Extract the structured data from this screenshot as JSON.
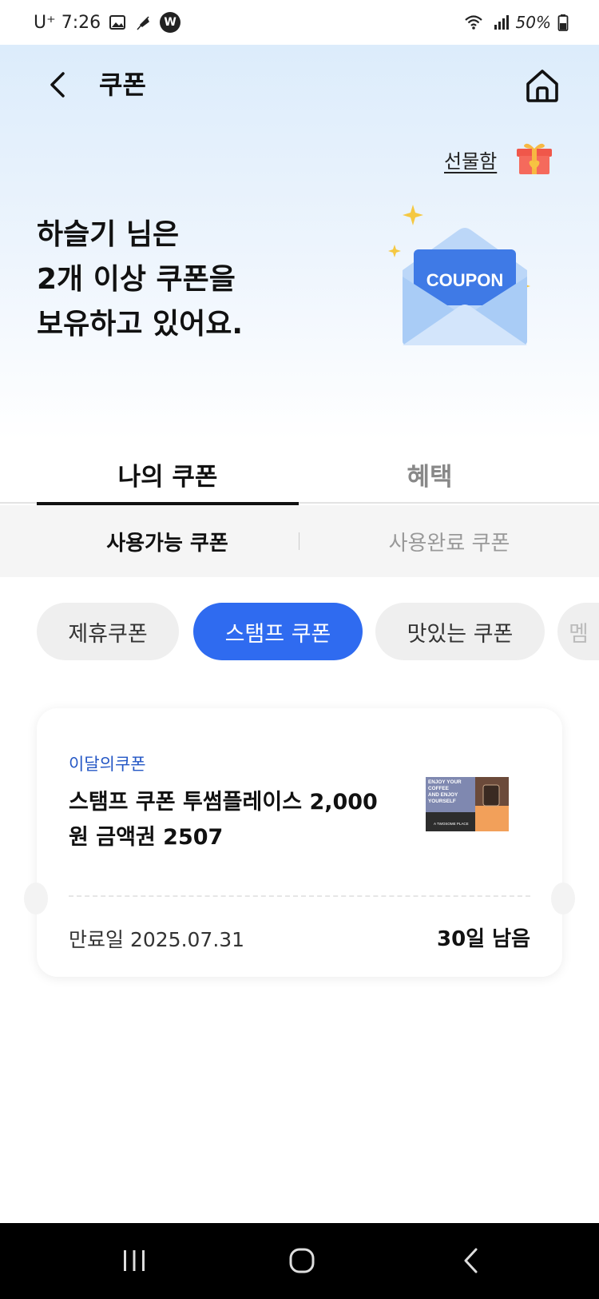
{
  "status_bar": {
    "carrier": "U⁺ 7:26",
    "battery": "50%",
    "wifi_icon": "wifi-icon",
    "signal_icon": "signal-icon",
    "battery_icon": "battery-icon",
    "app_badge": "W"
  },
  "header": {
    "title": "쿠폰",
    "back_icon": "chevron-left-icon",
    "home_icon": "home-icon"
  },
  "hero": {
    "gift_link": "선물함",
    "gift_icon": "gift-box-icon",
    "headline_lines": [
      "하슬기 님은",
      "2개 이상 쿠폰을",
      "보유하고 있어요."
    ],
    "coupon_art_label": "COUPON"
  },
  "main_tabs": [
    {
      "label": "나의 쿠폰",
      "active": true
    },
    {
      "label": "혜택",
      "active": false
    }
  ],
  "sub_tabs": [
    {
      "label": "사용가능 쿠폰",
      "active": true
    },
    {
      "label": "사용완료 쿠폰",
      "active": false
    }
  ],
  "filter_chips": [
    {
      "label": "제휴쿠폰",
      "selected": false
    },
    {
      "label": "스탬프 쿠폰",
      "selected": true
    },
    {
      "label": "맛있는 쿠폰",
      "selected": false
    },
    {
      "label": "멤",
      "selected": false
    }
  ],
  "coupons": [
    {
      "category": "이달의쿠폰",
      "title": "스탬프 쿠폰 투썸플레이스 2,000원 금액권 2507",
      "thumbnail_text": "ENJOY YOUR COFFEE AND ENJOY YOURSELF",
      "thumbnail_brand": "A TWOSOME PLACE",
      "expiry": "만료일 2025.07.31",
      "remaining": "30일 남음"
    }
  ],
  "nav": {
    "recents_icon": "recent-apps-icon",
    "home_icon": "home-circle-icon",
    "back_icon": "back-icon"
  },
  "colors": {
    "accent": "#2f6bf0",
    "category": "#2457c5",
    "hero_top": "#dcecfb"
  }
}
